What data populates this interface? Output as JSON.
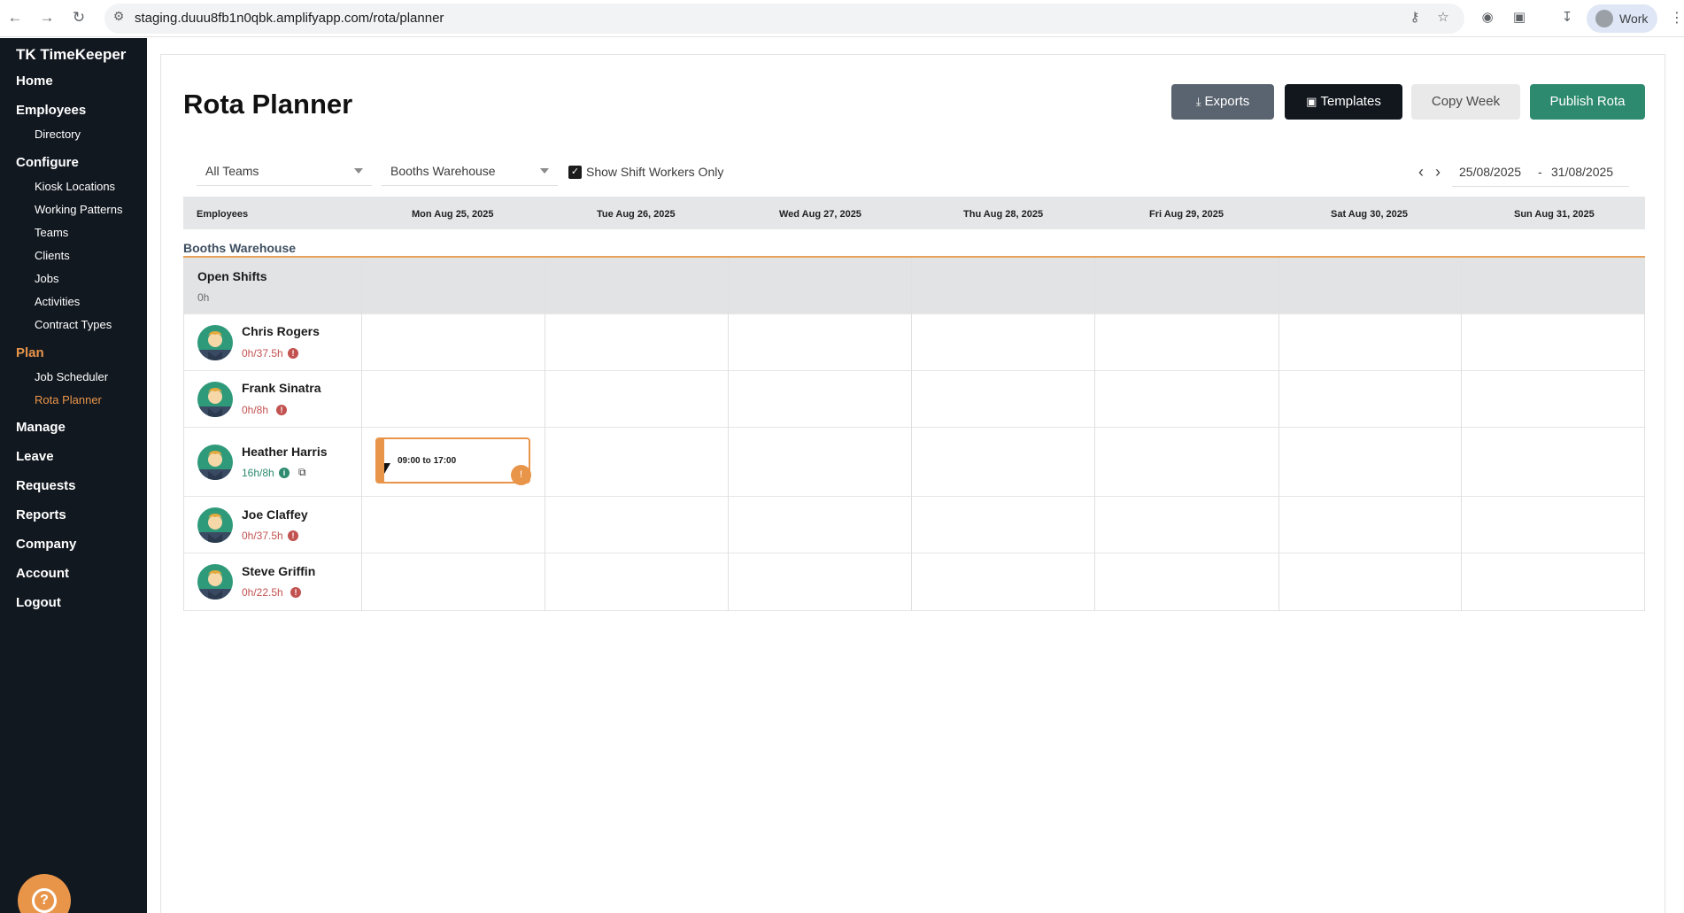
{
  "browser": {
    "url": "staging.duuu8fb1n0qbk.amplifyapp.com/rota/planner",
    "profile_label": "Work"
  },
  "sidebar": {
    "brand": "TK TimeKeeper",
    "sections": [
      {
        "label": "Home"
      },
      {
        "label": "Employees",
        "items": [
          "Directory"
        ]
      },
      {
        "label": "Configure",
        "items": [
          "Kiosk Locations",
          "Working Patterns",
          "Teams",
          "Clients",
          "Jobs",
          "Activities",
          "Contract Types"
        ]
      },
      {
        "label": "Plan",
        "items": [
          "Job Scheduler",
          "Rota Planner"
        ]
      },
      {
        "label": "Manage"
      },
      {
        "label": "Leave"
      },
      {
        "label": "Requests"
      },
      {
        "label": "Reports"
      },
      {
        "label": "Company"
      },
      {
        "label": "Account"
      },
      {
        "label": "Logout"
      }
    ],
    "active_section": "Plan",
    "active_item": "Rota Planner"
  },
  "page": {
    "title": "Rota Planner",
    "buttons": {
      "exports": "Exports",
      "templates": "Templates",
      "copy_week": "Copy Week",
      "publish": "Publish Rota"
    },
    "filters": {
      "teams": "All Teams",
      "site": "Booths Warehouse",
      "shift_workers_only_label": "Show Shift Workers Only",
      "shift_workers_only_checked": true
    },
    "date_range": {
      "start": "25/08/2025",
      "separator": "-",
      "end": "31/08/2025"
    }
  },
  "grid": {
    "columns": [
      "Employees",
      "Mon Aug 25, 2025",
      "Tue Aug 26, 2025",
      "Wed Aug 27, 2025",
      "Thu Aug 28, 2025",
      "Fri Aug 29, 2025",
      "Sat Aug 30, 2025",
      "Sun Aug 31, 2025"
    ],
    "group": "Booths Warehouse",
    "open_shifts": {
      "label": "Open Shifts",
      "hours": "0h"
    },
    "employees": [
      {
        "name": "Chris Rogers",
        "hours": "0h/37.5h",
        "status": "warning"
      },
      {
        "name": "Frank Sinatra",
        "hours": "0h/8h",
        "status": "warning"
      },
      {
        "name": "Heather Harris",
        "hours": "16h/8h",
        "status": "ok"
      },
      {
        "name": "Joe Claffey",
        "hours": "0h/37.5h",
        "status": "warning"
      },
      {
        "name": "Steve Griffin",
        "hours": "0h/22.5h",
        "status": "warning"
      }
    ],
    "shift": {
      "employee": "Heather Harris",
      "day": "Mon Aug 25, 2025",
      "time": "09:00 to 17:00"
    }
  },
  "colors": {
    "sidebar_bg": "#121820",
    "accent_orange": "#e8954a",
    "publish_green": "#2d8a6f",
    "exports_gray": "#5a6470",
    "warning_red": "#c25250"
  }
}
